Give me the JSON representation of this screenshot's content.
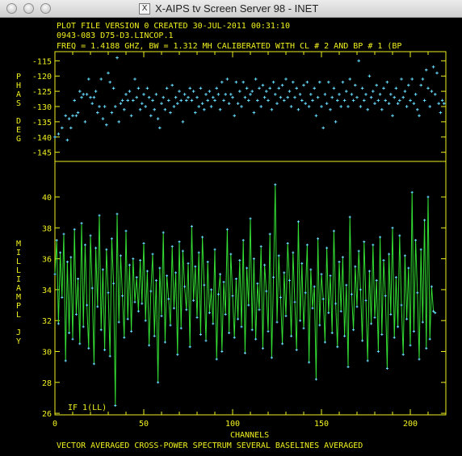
{
  "window": {
    "title": "X-AIPS tv Screen Server 98 - INET"
  },
  "header": {
    "line1": "PLOT FILE VERSION 0  CREATED 30-JUL-2011 00:31:10",
    "line2": "0943-083   D75-D3.LINCOP.1",
    "line3": "FREQ = 1.4188 GHZ, BW = 1.312 MH   CALIBERATED WITH CL # 2 AND BP # 1 (BP"
  },
  "footer": {
    "text": "VECTOR AVERAGED CROSS-POWER SPECTRUM     SEVERAL BASELINES AVERAGED"
  },
  "colors": {
    "axes": "#f0f020",
    "amplitude_line": "#33dd33",
    "points": "#66ddff",
    "background": "#000000"
  },
  "chart_data": [
    {
      "type": "scatter",
      "ylabel": "PHAS DEG",
      "ylim": [
        -148,
        -112
      ],
      "yticks": [
        "-115",
        "-120",
        "-125",
        "-130",
        "-135",
        "-140",
        "-145"
      ],
      "yvalues": [
        -115,
        -120,
        -125,
        -130,
        -135,
        -140,
        -145
      ],
      "xlim": [
        0,
        220
      ],
      "points": [
        [
          0,
          -140
        ],
        [
          2,
          -139
        ],
        [
          4,
          -137
        ],
        [
          6,
          -133
        ],
        [
          7,
          -141
        ],
        [
          8,
          -134
        ],
        [
          9,
          -137
        ],
        [
          10,
          -133
        ],
        [
          11,
          -128
        ],
        [
          12,
          -133
        ],
        [
          13,
          -132
        ],
        [
          14,
          -125
        ],
        [
          15,
          -127
        ],
        [
          16,
          -126
        ],
        [
          17,
          -135
        ],
        [
          18,
          -126
        ],
        [
          19,
          -121
        ],
        [
          20,
          -127
        ],
        [
          21,
          -129
        ],
        [
          22,
          -127
        ],
        [
          23,
          -125
        ],
        [
          24,
          -132
        ],
        [
          25,
          -130
        ],
        [
          26,
          -121
        ],
        [
          27,
          -134
        ],
        [
          28,
          -130
        ],
        [
          29,
          -136
        ],
        [
          30,
          -119
        ],
        [
          31,
          -122
        ],
        [
          32,
          -132
        ],
        [
          33,
          -124
        ],
        [
          34,
          -130
        ],
        [
          35,
          -114
        ],
        [
          36,
          -135
        ],
        [
          37,
          -129
        ],
        [
          38,
          -128
        ],
        [
          39,
          -131
        ],
        [
          40,
          -126
        ],
        [
          41,
          -128
        ],
        [
          42,
          -125
        ],
        [
          43,
          -133
        ],
        [
          44,
          -128
        ],
        [
          45,
          -121
        ],
        [
          46,
          -127
        ],
        [
          47,
          -124
        ],
        [
          48,
          -131
        ],
        [
          49,
          -129
        ],
        [
          50,
          -126
        ],
        [
          51,
          -130
        ],
        [
          52,
          -124
        ],
        [
          53,
          -127
        ],
        [
          54,
          -133
        ],
        [
          55,
          -128
        ],
        [
          56,
          -131
        ],
        [
          57,
          -126
        ],
        [
          58,
          -134
        ],
        [
          59,
          -137
        ],
        [
          60,
          -129
        ],
        [
          61,
          -127
        ],
        [
          62,
          -131
        ],
        [
          63,
          -124
        ],
        [
          64,
          -128
        ],
        [
          65,
          -132
        ],
        [
          66,
          -123
        ],
        [
          67,
          -130
        ],
        [
          68,
          -127
        ],
        [
          69,
          -129
        ],
        [
          70,
          -125
        ],
        [
          71,
          -128
        ],
        [
          72,
          -135
        ],
        [
          73,
          -126
        ],
        [
          74,
          -128
        ],
        [
          75,
          -127
        ],
        [
          76,
          -124
        ],
        [
          77,
          -128
        ],
        [
          78,
          -125
        ],
        [
          79,
          -132
        ],
        [
          80,
          -127
        ],
        [
          81,
          -130
        ],
        [
          82,
          -124
        ],
        [
          83,
          -129
        ],
        [
          84,
          -131
        ],
        [
          85,
          -126
        ],
        [
          86,
          -128
        ],
        [
          87,
          -125
        ],
        [
          88,
          -130
        ],
        [
          89,
          -127
        ],
        [
          90,
          -128
        ],
        [
          91,
          -124
        ],
        [
          92,
          -126
        ],
        [
          93,
          -131
        ],
        [
          94,
          -122
        ],
        [
          95,
          -128
        ],
        [
          96,
          -126
        ],
        [
          97,
          -121
        ],
        [
          98,
          -129
        ],
        [
          99,
          -126
        ],
        [
          100,
          -127
        ],
        [
          101,
          -133
        ],
        [
          102,
          -122
        ],
        [
          103,
          -129
        ],
        [
          104,
          -125
        ],
        [
          105,
          -130
        ],
        [
          106,
          -122
        ],
        [
          107,
          -127
        ],
        [
          108,
          -124
        ],
        [
          109,
          -128
        ],
        [
          110,
          -126
        ],
        [
          111,
          -125
        ],
        [
          112,
          -132
        ],
        [
          113,
          -121
        ],
        [
          114,
          -128
        ],
        [
          115,
          -124
        ],
        [
          116,
          -130
        ],
        [
          117,
          -123
        ],
        [
          118,
          -127
        ],
        [
          119,
          -125
        ],
        [
          120,
          -128
        ],
        [
          121,
          -124
        ],
        [
          122,
          -131
        ],
        [
          123,
          -122
        ],
        [
          124,
          -126
        ],
        [
          125,
          -129
        ],
        [
          126,
          -124
        ],
        [
          127,
          -127
        ],
        [
          128,
          -123
        ],
        [
          129,
          -128
        ],
        [
          130,
          -121
        ],
        [
          131,
          -127
        ],
        [
          132,
          -125
        ],
        [
          133,
          -130
        ],
        [
          134,
          -122
        ],
        [
          135,
          -127
        ],
        [
          136,
          -124
        ],
        [
          137,
          -131
        ],
        [
          138,
          -126
        ],
        [
          139,
          -128
        ],
        [
          140,
          -123
        ],
        [
          141,
          -129
        ],
        [
          142,
          -122
        ],
        [
          143,
          -130
        ],
        [
          144,
          -126
        ],
        [
          145,
          -128
        ],
        [
          146,
          -124
        ],
        [
          147,
          -133
        ],
        [
          148,
          -127
        ],
        [
          149,
          -122
        ],
        [
          150,
          -130
        ],
        [
          151,
          -137
        ],
        [
          152,
          -126
        ],
        [
          153,
          -129
        ],
        [
          154,
          -122
        ],
        [
          155,
          -131
        ],
        [
          156,
          -127
        ],
        [
          157,
          -124
        ],
        [
          158,
          -135
        ],
        [
          159,
          -128
        ],
        [
          160,
          -126
        ],
        [
          161,
          -130
        ],
        [
          162,
          -122
        ],
        [
          163,
          -128
        ],
        [
          164,
          -125
        ],
        [
          165,
          -130
        ],
        [
          166,
          -121
        ],
        [
          167,
          -126
        ],
        [
          168,
          -128
        ],
        [
          169,
          -123
        ],
        [
          170,
          -127
        ],
        [
          171,
          -115
        ],
        [
          172,
          -130
        ],
        [
          173,
          -124
        ],
        [
          174,
          -128
        ],
        [
          175,
          -126
        ],
        [
          176,
          -131
        ],
        [
          177,
          -120
        ],
        [
          178,
          -127
        ],
        [
          179,
          -125
        ],
        [
          180,
          -129
        ],
        [
          181,
          -123
        ],
        [
          182,
          -128
        ],
        [
          183,
          -126
        ],
        [
          184,
          -131
        ],
        [
          185,
          -124
        ],
        [
          186,
          -128
        ],
        [
          187,
          -122
        ],
        [
          188,
          -129
        ],
        [
          189,
          -126
        ],
        [
          190,
          -133
        ],
        [
          191,
          -127
        ],
        [
          192,
          -124
        ],
        [
          193,
          -129
        ],
        [
          194,
          -128
        ],
        [
          195,
          -121
        ],
        [
          196,
          -127
        ],
        [
          197,
          -125
        ],
        [
          198,
          -130
        ],
        [
          199,
          -123
        ],
        [
          200,
          -128
        ],
        [
          201,
          -121
        ],
        [
          202,
          -129
        ],
        [
          203,
          -126
        ],
        [
          204,
          -131
        ],
        [
          205,
          -133
        ],
        [
          206,
          -123
        ],
        [
          207,
          -121
        ],
        [
          208,
          -128
        ],
        [
          209,
          -118
        ],
        [
          210,
          -124
        ],
        [
          211,
          -130
        ],
        [
          212,
          -125
        ],
        [
          213,
          -117
        ],
        [
          214,
          -126
        ],
        [
          215,
          -119
        ],
        [
          216,
          -129
        ],
        [
          217,
          -132
        ],
        [
          218,
          -128
        ],
        [
          219,
          -129
        ]
      ]
    },
    {
      "type": "line",
      "ylabel": "MILLIAMPL JY",
      "xlabel": "CHANNELS",
      "annotation": "IF 1(LL)",
      "ylim": [
        25.9,
        42.3
      ],
      "yticks": [
        "40",
        "38",
        "36",
        "34",
        "32",
        "30",
        "28",
        "26"
      ],
      "yvalues": [
        40,
        38,
        36,
        34,
        32,
        30,
        28,
        26
      ],
      "xlim": [
        0,
        220
      ],
      "xticks": [
        "0",
        "50",
        "100",
        "150",
        "200"
      ],
      "xvalues": [
        0,
        50,
        100,
        150,
        200
      ],
      "y": [
        35.0,
        37.2,
        31.8,
        36.4,
        33.5,
        37.6,
        29.4,
        35.8,
        31.2,
        36.1,
        30.8,
        37.9,
        32.4,
        34.7,
        30.5,
        38.3,
        31.6,
        36.9,
        33.0,
        30.2,
        37.5,
        34.1,
        29.2,
        36.7,
        32.9,
        38.8,
        31.4,
        35.3,
        30.1,
        36.6,
        33.8,
        29.7,
        37.3,
        34.4,
        26.5,
        38.9,
        31.9,
        36.2,
        33.6,
        30.9,
        37.8,
        32.1,
        35.6,
        31.3,
        36.0,
        33.2,
        34.8,
        32.6,
        35.9,
        33.1,
        37.0,
        32.0,
        35.2,
        30.4,
        33.9,
        36.3,
        31.0,
        34.6,
        28.0,
        35.4,
        32.3,
        37.7,
        30.6,
        34.9,
        33.4,
        31.7,
        36.8,
        32.8,
        35.1,
        29.8,
        37.1,
        31.5,
        36.5,
        34.2,
        32.7,
        35.7,
        30.3,
        38.1,
        33.3,
        35.5,
        32.2,
        36.4,
        31.1,
        37.4,
        34.3,
        30.7,
        35.8,
        32.5,
        34.0,
        31.8,
        36.6,
        29.5,
        33.7,
        35.0,
        30.0,
        34.5,
        32.4,
        37.9,
        31.2,
        36.3,
        33.6,
        30.9,
        34.7,
        32.1,
        35.9,
        31.6,
        37.2,
        29.9,
        35.4,
        33.0,
        38.6,
        31.4,
        36.0,
        30.8,
        34.4,
        32.7,
        36.8,
        30.2,
        35.6,
        33.9,
        31.3,
        37.6,
        29.6,
        34.8,
        40.8,
        31.9,
        36.2,
        33.5,
        30.5,
        35.1,
        32.3,
        37.0,
        34.6,
        31.0,
        36.4,
        33.2,
        30.1,
        38.4,
        32.0,
        35.7,
        31.5,
        33.8,
        36.9,
        29.3,
        35.3,
        32.8,
        34.2,
        28.2,
        37.3,
        31.7,
        35.0,
        33.4,
        30.6,
        36.7,
        32.5,
        34.9,
        31.2,
        37.8,
        33.1,
        30.3,
        35.8,
        32.6,
        36.1,
        31.0,
        34.3,
        29.0,
        38.7,
        33.7,
        31.4,
        35.5,
        32.9,
        36.5,
        34.0,
        30.7,
        37.1,
        33.3,
        29.4,
        35.2,
        31.8,
        36.9,
        32.2,
        34.6,
        30.0,
        37.4,
        31.1,
        35.9,
        33.6,
        28.9,
        36.3,
        32.4,
        38.0,
        30.9,
        34.8,
        31.6,
        37.5,
        33.0,
        29.8,
        36.2,
        32.1,
        35.4,
        30.4,
        40.3,
        31.3,
        37.2,
        33.8,
        29.5,
        36.6,
        31.9,
        38.5,
        30.2,
        40.0,
        30.8,
        34.2,
        32.6,
        32.5
      ]
    }
  ]
}
